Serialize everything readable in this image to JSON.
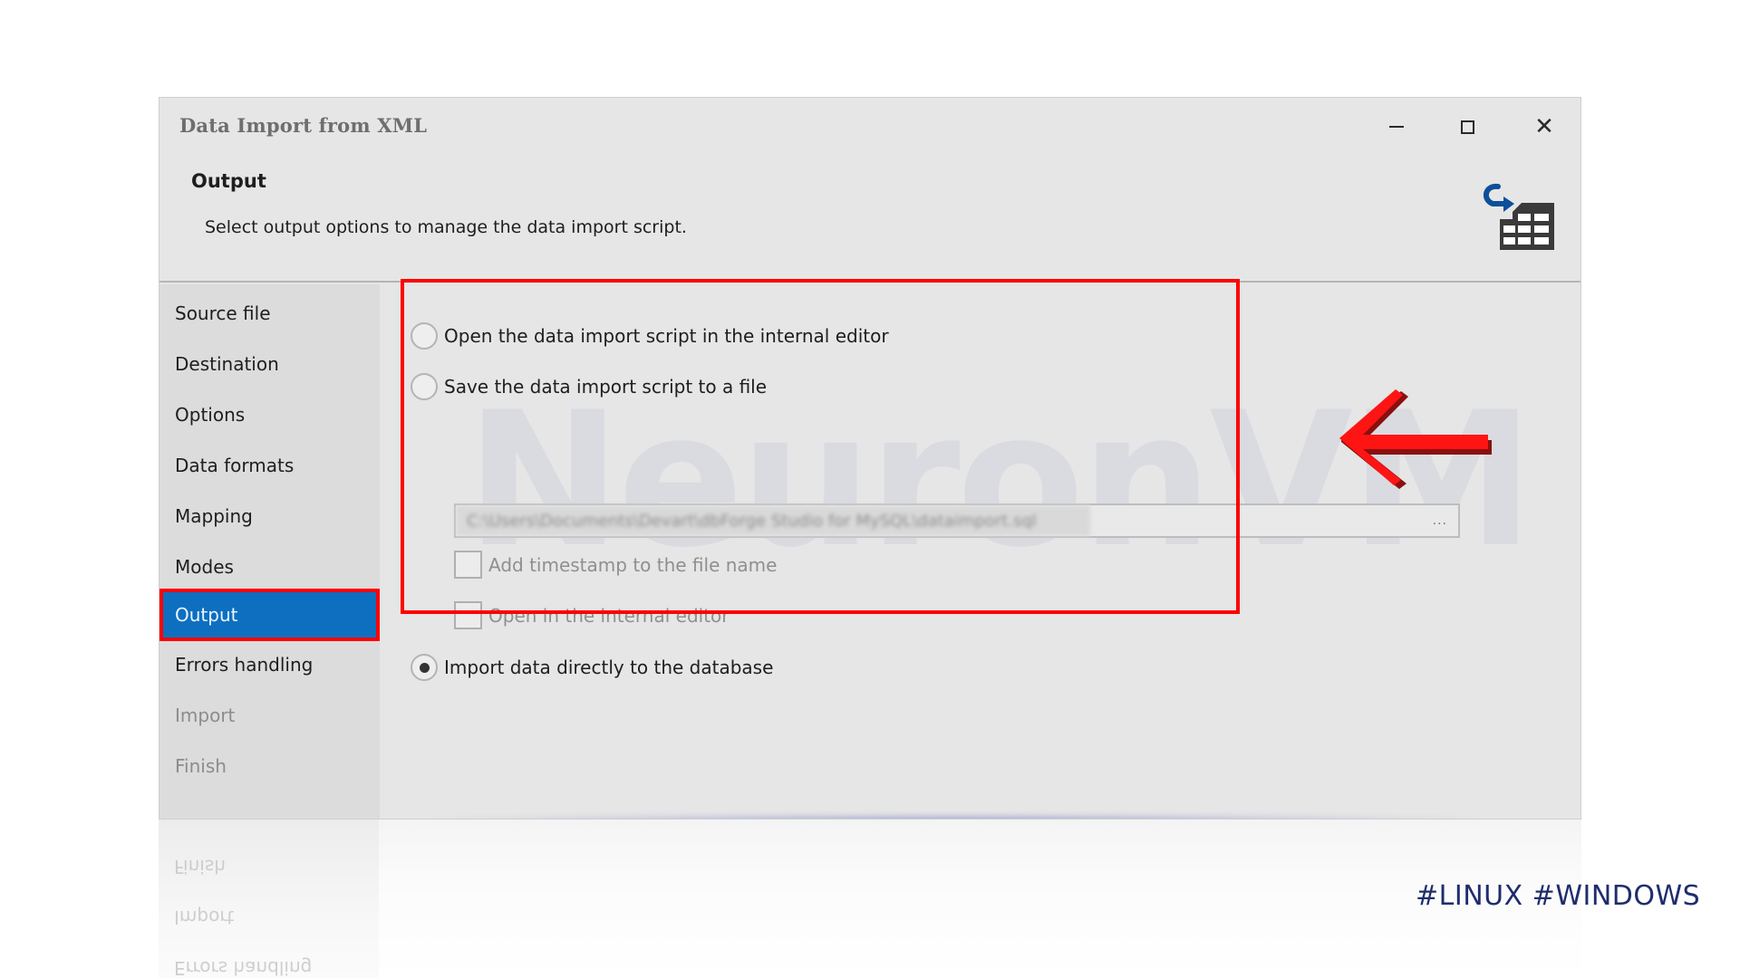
{
  "window": {
    "title": "Data Import from XML",
    "controls": {
      "minimize": "minimize",
      "maximize": "maximize",
      "close": "✕"
    }
  },
  "header": {
    "heading": "Output",
    "description": "Select output options to manage the data import script.",
    "icon": "import-to-table-icon"
  },
  "sidebar": {
    "items": [
      {
        "label": "Source file",
        "state": "enabled"
      },
      {
        "label": "Destination",
        "state": "enabled"
      },
      {
        "label": "Options",
        "state": "enabled"
      },
      {
        "label": "Data formats",
        "state": "enabled"
      },
      {
        "label": "Mapping",
        "state": "enabled"
      },
      {
        "label": "Modes",
        "state": "enabled"
      },
      {
        "label": "Output",
        "state": "selected"
      },
      {
        "label": "Errors handling",
        "state": "enabled"
      },
      {
        "label": "Import",
        "state": "disabled"
      },
      {
        "label": "Finish",
        "state": "disabled"
      }
    ]
  },
  "output_options": {
    "radio_open_editor": {
      "label": "Open the data import script in the internal editor",
      "checked": false
    },
    "radio_save_file": {
      "label": "Save the data import script to a file",
      "checked": false
    },
    "file_path": {
      "value": "C:\\Users\\Documents\\Devart\\dbForge Studio for MySQL\\dataimport.sql",
      "browse_label": "..."
    },
    "check_timestamp": {
      "label": "Add timestamp to the file name",
      "checked": false,
      "enabled": false
    },
    "check_open_internal": {
      "label": "Open in the internal editor",
      "checked": false,
      "enabled": false
    },
    "radio_import_direct": {
      "label": "Import data directly to the database",
      "checked": true
    }
  },
  "annotations": {
    "highlight_color": "#ff0000",
    "arrow": "red-arrow-pointing-left"
  },
  "watermark": "NeuronVM",
  "reflection_items": [
    "Finish",
    "Import",
    "Errors handling"
  ],
  "footer": {
    "hashtags": "#LINUX #WINDOWS"
  },
  "colors": {
    "selected_bg": "#0e6fc0",
    "window_bg": "#e6e6e6",
    "sidebar_bg": "#dcdcdc",
    "hashtag": "#1f2d6d"
  }
}
